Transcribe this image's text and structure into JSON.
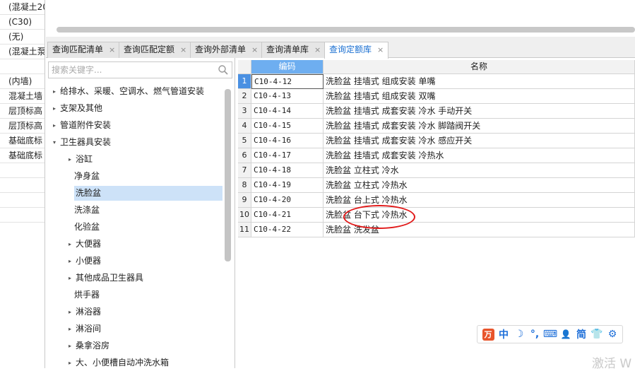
{
  "left_strip": {
    "rows": [
      "(混凝土20",
      "(C30)",
      "(无)",
      "(混凝土泵",
      "",
      "(内墙)",
      "混凝土墙",
      "层顶标高",
      "层顶标高",
      "基础底标",
      "基础底标",
      "",
      "",
      "",
      ""
    ]
  },
  "tabs": [
    {
      "label": "查询匹配清单",
      "close": "×"
    },
    {
      "label": "查询匹配定额",
      "close": "×"
    },
    {
      "label": "查询外部清单",
      "close": "×"
    },
    {
      "label": "查询清单库",
      "close": "×"
    },
    {
      "label": "查询定额库",
      "close": "×"
    }
  ],
  "search": {
    "placeholder": "搜索关键字..."
  },
  "tree": [
    {
      "label": "给排水、采暖、空调水、燃气管道安装",
      "arrow": "▸"
    },
    {
      "label": "支架及其他",
      "arrow": "▸"
    },
    {
      "label": "管道附件安装",
      "arrow": "▸"
    },
    {
      "label": "卫生器具安装",
      "arrow": "▾"
    },
    {
      "label": "浴缸",
      "arrow": "▸"
    },
    {
      "label": "净身盆",
      "arrow": ""
    },
    {
      "label": "洗脸盆",
      "arrow": ""
    },
    {
      "label": "洗涤盆",
      "arrow": ""
    },
    {
      "label": "化验盆",
      "arrow": ""
    },
    {
      "label": "大便器",
      "arrow": "▸"
    },
    {
      "label": "小便器",
      "arrow": "▸"
    },
    {
      "label": "其他成品卫生器具",
      "arrow": "▸"
    },
    {
      "label": "烘手器",
      "arrow": ""
    },
    {
      "label": "淋浴器",
      "arrow": "▸"
    },
    {
      "label": "淋浴间",
      "arrow": "▸"
    },
    {
      "label": "桑拿浴房",
      "arrow": "▸"
    },
    {
      "label": "大、小便槽自动冲洗水箱",
      "arrow": "▸"
    }
  ],
  "grid": {
    "headers": {
      "code": "编码",
      "name": "名称"
    },
    "rows": [
      {
        "num": "1",
        "code": "C10-4-12",
        "name": "洗脸盆 挂墙式 组成安装 单嘴"
      },
      {
        "num": "2",
        "code": "C10-4-13",
        "name": "洗脸盆 挂墙式 组成安装 双嘴"
      },
      {
        "num": "3",
        "code": "C10-4-14",
        "name": "洗脸盆 挂墙式 成套安装 冷水 手动开关"
      },
      {
        "num": "4",
        "code": "C10-4-15",
        "name": "洗脸盆 挂墙式 成套安装 冷水 脚踏阀开关"
      },
      {
        "num": "5",
        "code": "C10-4-16",
        "name": "洗脸盆 挂墙式 成套安装 冷水 感应开关"
      },
      {
        "num": "6",
        "code": "C10-4-17",
        "name": "洗脸盆 挂墙式 成套安装 冷热水"
      },
      {
        "num": "7",
        "code": "C10-4-18",
        "name": "洗脸盆 立柱式 冷水"
      },
      {
        "num": "8",
        "code": "C10-4-19",
        "name": "洗脸盆 立柱式 冷热水"
      },
      {
        "num": "9",
        "code": "C10-4-20",
        "name": "洗脸盆 台上式 冷热水"
      },
      {
        "num": "10",
        "code": "C10-4-21",
        "name": "洗脸盆 台下式 冷热水"
      },
      {
        "num": "11",
        "code": "C10-4-22",
        "name": "洗脸盆 洗发盆"
      }
    ]
  },
  "ime": {
    "logo": "万",
    "items": [
      "中",
      "☽",
      "°,",
      "⌨",
      "👤",
      "简",
      "👕",
      "⚙"
    ]
  },
  "watermark": "激活 W"
}
